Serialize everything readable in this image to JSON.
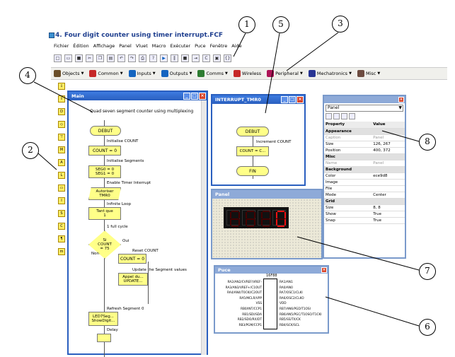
{
  "app": {
    "title": "4. Four digit counter using timer interrupt.FCF"
  },
  "menu": [
    "Fichier",
    "Édition",
    "Affichage",
    "Panel",
    "Vluet",
    "Macro",
    "Exécuter",
    "Puce",
    "Fenêtre",
    "Aide"
  ],
  "components": [
    {
      "label": "Objects",
      "color": "#6b4f2a"
    },
    {
      "label": "Common",
      "color": "#c62828"
    },
    {
      "label": "Inputs",
      "color": "#1565c0"
    },
    {
      "label": "Outputs",
      "color": "#1565c0"
    },
    {
      "label": "Comms",
      "color": "#2e7d32"
    },
    {
      "label": "Wireless",
      "color": "#c62828"
    },
    {
      "label": "Peripheral",
      "color": "#ad1457"
    },
    {
      "label": "Mechatronics",
      "color": "#283593"
    },
    {
      "label": "Misc",
      "color": "#6d4c41"
    }
  ],
  "main": {
    "title": "Main",
    "comment": "Quad seven segment counter using multiplexing",
    "blocks": {
      "debut": "DEBUT",
      "init_count_cap": "Initialise COUNT",
      "count0": "COUNT = 0",
      "init_seg_cap": "Initialise Segments",
      "segs1": "SEG0 = 0",
      "segs2": "SEG1 = 0",
      "enable_cap": "Enable Timer Interrupt",
      "interrupt1": "Autoriser",
      "interrupt2": "TMR0",
      "loop_cap": "Infinite Loop",
      "loop1": "Tant que",
      "loop2": "1",
      "cycle_cap": "1 full cycle",
      "dec1": "Si",
      "dec2": "COUNT",
      "dec3": "= 75",
      "oui": "Oui",
      "non": "Non",
      "reset_cap": "Reset COUNT",
      "reset_blk": "COUNT = 0",
      "update_cap": "Update the Segment values",
      "call1": "Appel du...",
      "call2": "UPDATE...",
      "refresh_cap": "Refresh Segment 0",
      "led1": "LED7Seg...",
      "led2": "ShowDigit...",
      "delay_cap": "Delay"
    }
  },
  "interrupt": {
    "title": "INTERRUPT_TMR0",
    "debut": "DEBUT",
    "inc_cap": "Increment COUNT",
    "calc": "COUNT = C...",
    "fin": "FIN"
  },
  "panelwin": {
    "title": "Panel"
  },
  "props": {
    "title_select": "Panel",
    "col_property": "Property",
    "col_value": "Value",
    "rows": [
      {
        "k": "Appearance",
        "v": "",
        "sect": true
      },
      {
        "k": "Caption",
        "v": "Panel",
        "gray": true
      },
      {
        "k": "Size",
        "v": "126, 267"
      },
      {
        "k": "Position",
        "v": "400, 372"
      },
      {
        "k": "Misc",
        "v": "",
        "sect": true
      },
      {
        "k": "Name",
        "v": "Panel",
        "gray": true
      },
      {
        "k": "Background",
        "v": "",
        "sect": true
      },
      {
        "k": "Color",
        "v": "ece9d8"
      },
      {
        "k": "Image",
        "v": ""
      },
      {
        "k": "File",
        "v": ""
      },
      {
        "k": "Mode",
        "v": "Center"
      },
      {
        "k": "Grid",
        "v": "",
        "sect": true
      },
      {
        "k": "Size",
        "v": "8, 8"
      },
      {
        "k": "Show",
        "v": "True"
      },
      {
        "k": "Snap",
        "v": "True"
      }
    ]
  },
  "puce": {
    "title": "Puce",
    "chip": "16F88",
    "left": [
      "RA2/AN2/CVREF/VREF-",
      "RA3/AN3/VREF+/C1OUT",
      "RA4/AN4/T0CKI/C2OUT",
      "RA5/MCLR/VPP",
      "VSS",
      "RB0/INT/CCP1",
      "RB1/SDI/SDA",
      "RB2/SDO/RX/DT",
      "RB3/PGM/CCP1"
    ],
    "right": [
      "RA1/AN1",
      "RA0/AN0",
      "RA7/OSC1/CLKI",
      "RA6/OSC2/CLKO",
      "VDD",
      "RB7/AN6/PGD/T1OSI",
      "RB6/AN5/PGC/T1OSO/T1CKI",
      "RB5/SS/TX/CK",
      "RB4/SCK/SCL"
    ]
  },
  "callouts": [
    "1",
    "2",
    "3",
    "4",
    "5",
    "6",
    "7",
    "8"
  ],
  "display_digits": [
    " ",
    " ",
    " ",
    "0"
  ]
}
